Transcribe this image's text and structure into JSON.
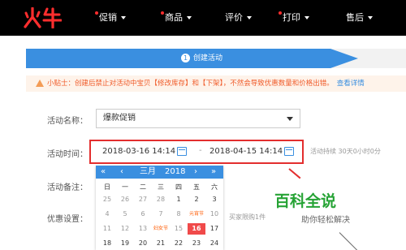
{
  "nav": {
    "logo": "火牛",
    "items": [
      {
        "label": "促销"
      },
      {
        "label": "商品"
      },
      {
        "label": "评价"
      },
      {
        "label": "打印"
      },
      {
        "label": "售后"
      }
    ]
  },
  "steps": {
    "current_number": "1",
    "current_label": "创建活动"
  },
  "tip": {
    "text": "小贴士：创建后禁止对活动中宝贝【修改库存】和【下架】，不然会导致优惠数量和价格出错。",
    "link": "查看详情"
  },
  "form": {
    "name_label": "活动名称：",
    "name_value": "爆款促销",
    "time_label": "活动时间：",
    "start_value": "2018-03-16 14:14",
    "date_separator": "-",
    "end_value": "2018-04-15 14:14",
    "duration": "活动持续 30天0小时0分",
    "remark_label": "活动备注：",
    "discount_label": "优惠设置：",
    "limit_text": "买家限购1件"
  },
  "calendar": {
    "prev_year": "«",
    "prev_month": "‹",
    "month": "三月",
    "year": "2018",
    "next_month": "›",
    "next_year": "»",
    "weekdays": [
      "日",
      "一",
      "二",
      "三",
      "四",
      "五",
      "六"
    ],
    "rows": [
      [
        {
          "t": "25",
          "k": "other"
        },
        {
          "t": "26",
          "k": "other"
        },
        {
          "t": "27",
          "k": "other"
        },
        {
          "t": "28",
          "k": "other"
        },
        {
          "t": "1",
          "k": "cur"
        },
        {
          "t": "2",
          "k": "cur"
        },
        {
          "t": "3",
          "k": "cur"
        }
      ],
      [
        {
          "t": "4",
          "k": "other"
        },
        {
          "t": "5",
          "k": "other"
        },
        {
          "t": "6",
          "k": "other"
        },
        {
          "t": "7",
          "k": "other"
        },
        {
          "t": "8",
          "k": "other"
        },
        {
          "t": "元宵节",
          "k": "hol"
        },
        {
          "t": "10",
          "k": "other"
        }
      ],
      [
        {
          "t": "11",
          "k": "other"
        },
        {
          "t": "12",
          "k": "other"
        },
        {
          "t": "13",
          "k": "other"
        },
        {
          "t": "妇女节",
          "k": "hol"
        },
        {
          "t": "15",
          "k": "other"
        },
        {
          "t": "16",
          "k": "today"
        },
        {
          "t": "17",
          "k": "cur"
        }
      ],
      [
        {
          "t": "18",
          "k": "cur"
        },
        {
          "t": "19",
          "k": "cur"
        },
        {
          "t": "20",
          "k": "cur"
        },
        {
          "t": "21",
          "k": "cur"
        },
        {
          "t": "22",
          "k": "cur"
        },
        {
          "t": "23",
          "k": "cur"
        },
        {
          "t": "24",
          "k": "cur"
        }
      ]
    ]
  },
  "watermark": {
    "title": "百科全说",
    "subtitle": "助你轻松解决"
  },
  "colors": {
    "accent": "#3a8fe0",
    "highlight_red": "#e32e2e",
    "today": "#f04a4a",
    "holiday": "#ff5a00",
    "brand_green": "#26a335"
  }
}
